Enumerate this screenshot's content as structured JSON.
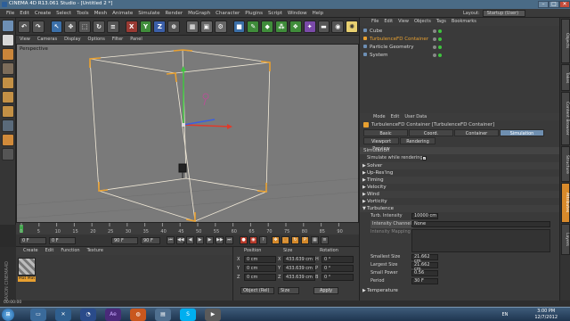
{
  "window": {
    "title": "CINEMA 4D R13.061 Studio - [Untitled 2 *]",
    "minimize": "–",
    "maximize": "□",
    "close": "✕"
  },
  "menu": [
    "File",
    "Edit",
    "Create",
    "Select",
    "Tools",
    "Mesh",
    "Animate",
    "Simulate",
    "Render",
    "MoGraph",
    "Character",
    "Plugins",
    "Script",
    "Window",
    "Help"
  ],
  "layout_label": "Layout:",
  "layout_value": "Startup (User)",
  "toolbar": {
    "x_label": "X",
    "y_label": "Y",
    "z_label": "Z"
  },
  "viewport": {
    "menu": [
      "View",
      "Cameras",
      "Display",
      "Options",
      "Filter",
      "Panel"
    ],
    "label": "Perspective"
  },
  "timeline": {
    "ticks": [
      "0",
      "5",
      "10",
      "15",
      "20",
      "25",
      "30",
      "35",
      "40",
      "45",
      "50",
      "55",
      "60",
      "65",
      "70",
      "75",
      "80",
      "85",
      "90"
    ],
    "frame_display": "0 F"
  },
  "transport": {
    "start": "0 F",
    "current": "0 F",
    "end": "90 F",
    "max": "90 F"
  },
  "material_manager": {
    "menu": [
      "Create",
      "Edit",
      "Function",
      "Texture"
    ],
    "material_name": "Mat Mat",
    "watermark": "MAXON CINEMA4D"
  },
  "coordinates": {
    "headers": [
      "Position",
      "Size",
      "Rotation"
    ],
    "rows": [
      {
        "pos_axis": "X",
        "pos": "0 cm",
        "size_axis": "X",
        "size": "433.639 cm",
        "rot_axis": "H",
        "rot": "0 °"
      },
      {
        "pos_axis": "Y",
        "pos": "0 cm",
        "size_axis": "Y",
        "size": "433.639 cm",
        "rot_axis": "P",
        "rot": "0 °"
      },
      {
        "pos_axis": "Z",
        "pos": "0 cm",
        "size_axis": "Z",
        "size": "433.639 cm",
        "rot_axis": "B",
        "rot": "0 °"
      }
    ],
    "mode_select": "Object (Rel)",
    "size_select": "Size",
    "apply": "Apply"
  },
  "object_manager": {
    "menu": [
      "File",
      "Edit",
      "View",
      "Objects",
      "Tags",
      "Bookmarks"
    ],
    "objects": [
      {
        "name": "Cube",
        "color": "#d8d8d8",
        "selected": false
      },
      {
        "name": "TurbulenceFD Container",
        "color": "#e8a030",
        "selected": true
      },
      {
        "name": "Particle Geometry",
        "color": "#d8d8d8",
        "selected": false
      },
      {
        "name": "System",
        "color": "#d8d8d8",
        "selected": false
      }
    ]
  },
  "attributes": {
    "menu": [
      "Mode",
      "Edit",
      "User Data"
    ],
    "object_title": "TurbulenceFD Container [TurbulenceFD Container]",
    "tabs": [
      "Basic",
      "Coord.",
      "Container",
      "Simulation"
    ],
    "tabs2": [
      "Viewport Preview",
      "Rendering"
    ],
    "active_tab": "Simulation",
    "section_title": "Simulation",
    "simulate_label": "Simulate while rendering",
    "sections": [
      "Solver",
      "Up-Res'ing",
      "Timing",
      "Velocity",
      "Wind",
      "Vorticity",
      "Turbulence"
    ],
    "turbulence": {
      "intensity_label": "Turb. Intensity",
      "intensity_value": "10000 cm",
      "channel_label": "Intensity Channel",
      "channel_value": "None",
      "mapping_label": "Intensity Mapping",
      "smallest_label": "Smallest Size",
      "smallest_value": "21.662 cm",
      "largest_label": "Largest Size",
      "largest_value": "21.662 cm",
      "power_label": "Small Power",
      "power_value": "0.56",
      "period_label": "Period",
      "period_value": "30 F"
    },
    "last_section": "Temperature"
  },
  "side_tabs": [
    "Objects",
    "Takes",
    "Content Browser",
    "Structure",
    "Attributes",
    "Layers"
  ],
  "status": "00:00:00",
  "taskbar": {
    "lang": "EN",
    "time": "3:00 PM",
    "date": "12/7/2012"
  }
}
